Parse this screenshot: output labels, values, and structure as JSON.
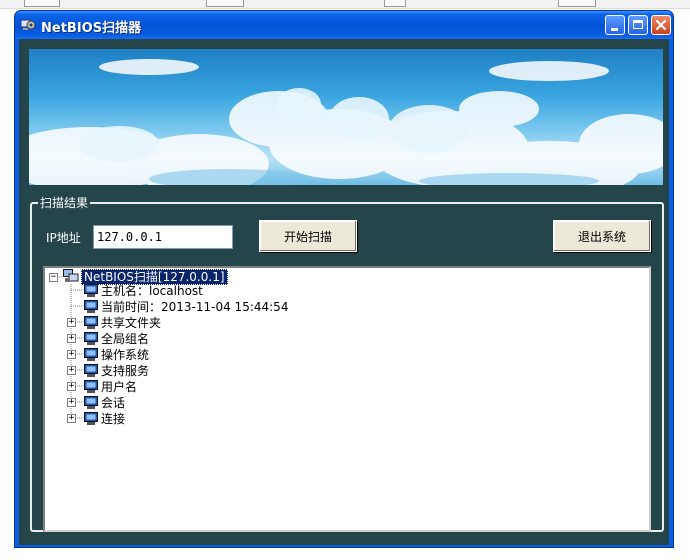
{
  "window": {
    "title": "NetBIOS扫描器"
  },
  "scan": {
    "group_label": "扫描结果",
    "ip_label": "IP地址",
    "ip_value": "127.0.0.1",
    "start_button": "开始扫描",
    "exit_button": "退出系统"
  },
  "tree": {
    "root": "NetBIOS扫描[127.0.0.1]",
    "items": [
      {
        "label": "主机名：localhost",
        "expandable": false
      },
      {
        "label": "当前时间：2013-11-04 15:44:54",
        "expandable": false
      },
      {
        "label": "共享文件夹",
        "expandable": true
      },
      {
        "label": "全局组名",
        "expandable": true
      },
      {
        "label": "操作系统",
        "expandable": true
      },
      {
        "label": "支持服务",
        "expandable": true
      },
      {
        "label": "用户名",
        "expandable": true
      },
      {
        "label": "会话",
        "expandable": true
      },
      {
        "label": "连接",
        "expandable": true
      }
    ]
  },
  "colors": {
    "titlebar": "#0453d6",
    "client_bg": "#24454a",
    "button_face": "#ece9d8",
    "selection": "#0a246a"
  },
  "icons": {
    "app": "gear-computer-icon",
    "node": "computer-icon",
    "root": "network-computer-icon"
  }
}
